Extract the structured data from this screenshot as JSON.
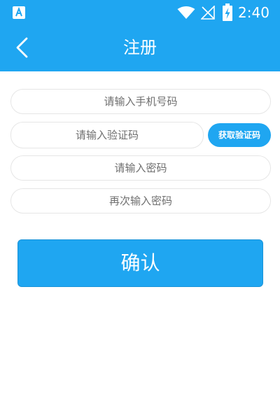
{
  "status_bar": {
    "app_icon": "app-a-icon",
    "time": "2:40",
    "icons": [
      "wifi-icon",
      "no-signal-icon",
      "battery-charging-icon"
    ]
  },
  "header": {
    "back_icon": "chevron-left-icon",
    "title": "注册"
  },
  "form": {
    "phone_placeholder": "请输入手机号码",
    "code_placeholder": "请输入验证码",
    "get_code_label": "获取验证码",
    "password_placeholder": "请输入密码",
    "confirm_password_placeholder": "再次输入密码"
  },
  "actions": {
    "confirm_label": "确认"
  },
  "colors": {
    "primary": "#1fa6f1",
    "field_border": "#e6e6e6",
    "placeholder_text": "#6f6f6f",
    "background": "#ffffff"
  }
}
